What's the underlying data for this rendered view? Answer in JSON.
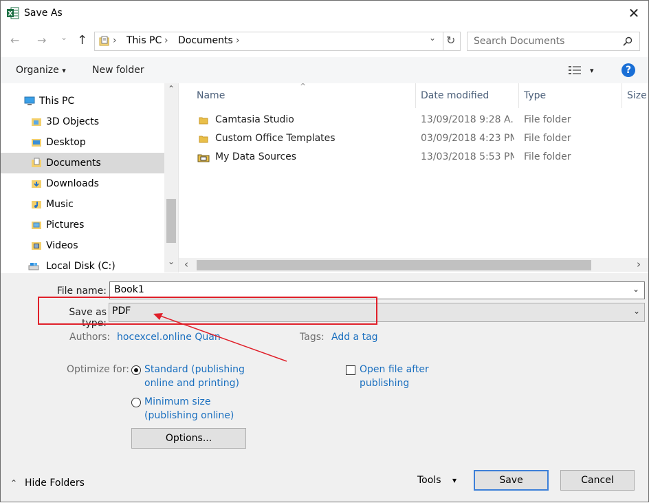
{
  "window": {
    "title": "Save As",
    "close_glyph": "✕"
  },
  "nav": {
    "back_glyph": "←",
    "forward_glyph": "→",
    "recent_glyph": "⌄",
    "up_glyph": "↑",
    "breadcrumb": [
      "This PC",
      "Documents"
    ],
    "chevron_glyph": "›",
    "dropdown_glyph": "⌄",
    "refresh_glyph": "↻",
    "search_placeholder": "Search Documents",
    "search_icon_glyph": "⚲"
  },
  "toolbar": {
    "organize": "Organize",
    "organize_caret": "▾",
    "new_folder": "New folder",
    "view_caret": "▾",
    "help_glyph": "?"
  },
  "tree": {
    "items": [
      {
        "label": "This PC",
        "icon": "pc-icon"
      },
      {
        "label": "3D Objects",
        "icon": "folder-3d-icon"
      },
      {
        "label": "Desktop",
        "icon": "folder-desktop-icon"
      },
      {
        "label": "Documents",
        "icon": "folder-documents-icon",
        "selected": true
      },
      {
        "label": "Downloads",
        "icon": "folder-downloads-icon"
      },
      {
        "label": "Music",
        "icon": "folder-music-icon"
      },
      {
        "label": "Pictures",
        "icon": "folder-pictures-icon"
      },
      {
        "label": "Videos",
        "icon": "folder-videos-icon"
      },
      {
        "label": "Local Disk (C:)",
        "icon": "disk-icon"
      }
    ],
    "scroll_up": "⌃",
    "scroll_down": "⌄"
  },
  "files": {
    "columns": [
      "Name",
      "Date modified",
      "Type",
      "Size"
    ],
    "sort_glyph": "^",
    "rows": [
      {
        "name": "Camtasia Studio",
        "date": "13/09/2018 9:28 A...",
        "type": "File folder"
      },
      {
        "name": "Custom Office Templates",
        "date": "03/09/2018 4:23 PM",
        "type": "File folder"
      },
      {
        "name": "My Data Sources",
        "date": "13/03/2018 5:53 PM",
        "type": "File folder"
      }
    ],
    "hscroll_left": "‹",
    "hscroll_right": "›"
  },
  "form": {
    "file_name_label": "File name:",
    "file_name_value": "Book1",
    "save_type_label": "Save as type:",
    "save_type_value": "PDF",
    "authors_label": "Authors:",
    "authors_value": "hocexcel.online Quan",
    "tags_label": "Tags:",
    "tags_value": "Add a tag",
    "optimize_label": "Optimize for:",
    "opt_standard_line1": "Standard (publishing",
    "opt_standard_line2": "online and printing)",
    "opt_min_line1": "Minimum size",
    "opt_min_line2": "(publishing online)",
    "open_after_line1": "Open file after",
    "open_after_line2": "publishing",
    "options_button": "Options..."
  },
  "footer": {
    "hide_folders": "Hide Folders",
    "hide_caret": "⌃",
    "tools": "Tools",
    "tools_caret": "▾",
    "save": "Save",
    "cancel": "Cancel"
  },
  "colors": {
    "accent": "#1a6fbf",
    "highlight": "#e0202a",
    "selection": "#d9d9d9"
  }
}
